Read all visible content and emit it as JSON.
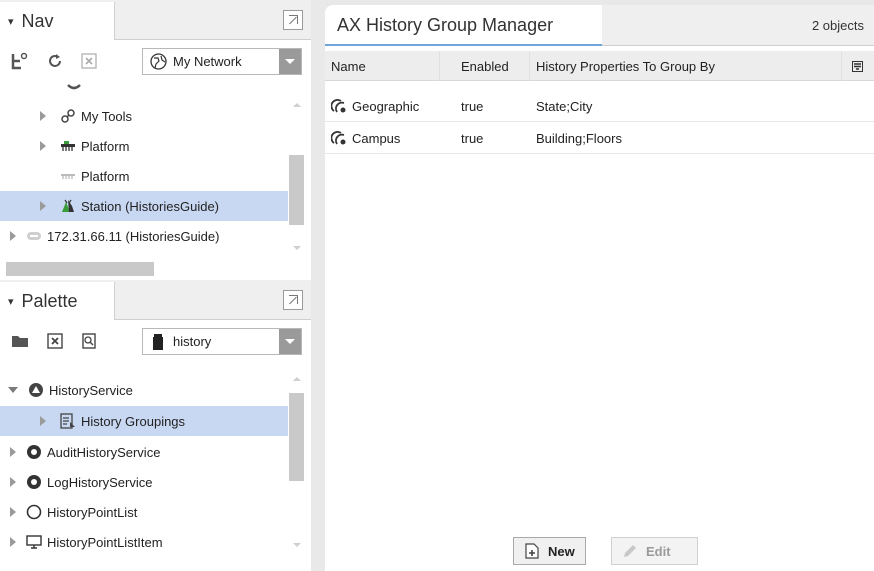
{
  "nav": {
    "title": "Nav",
    "network_dropdown": "My Network",
    "tree": [
      {
        "label": "My Tools",
        "icon": "tools-icon"
      },
      {
        "label": "Platform",
        "icon": "platform-icon"
      },
      {
        "label": "Platform",
        "icon": "platform-icon"
      },
      {
        "label": "Station (HistoriesGuide)",
        "icon": "station-icon",
        "selected": true
      },
      {
        "label": "172.31.66.11 (HistoriesGuide)",
        "icon": "host-icon"
      }
    ]
  },
  "palette": {
    "title": "Palette",
    "module_dropdown": "history",
    "tree": [
      {
        "label": "HistoryService",
        "icon": "service-icon"
      },
      {
        "label": "History Groupings",
        "icon": "groupings-icon",
        "selected": true
      },
      {
        "label": "AuditHistoryService",
        "icon": "service-icon"
      },
      {
        "label": "LogHistoryService",
        "icon": "service-icon"
      },
      {
        "label": "HistoryPointList",
        "icon": "service-icon"
      },
      {
        "label": "HistoryPointListItem",
        "icon": "monitor-icon"
      }
    ]
  },
  "manager": {
    "title": "AX History Group Manager",
    "count": "2 objects",
    "columns": [
      "Name",
      "Enabled",
      "History Properties To Group By"
    ],
    "rows": [
      {
        "name": "Geographic",
        "enabled": "true",
        "props": "State;City"
      },
      {
        "name": "Campus",
        "enabled": "true",
        "props": "Building;Floors"
      }
    ],
    "buttons": {
      "new": "New",
      "edit": "Edit"
    }
  },
  "colors": {
    "selection": "#c9d8f2",
    "title_underline": "#6ea6d9"
  }
}
